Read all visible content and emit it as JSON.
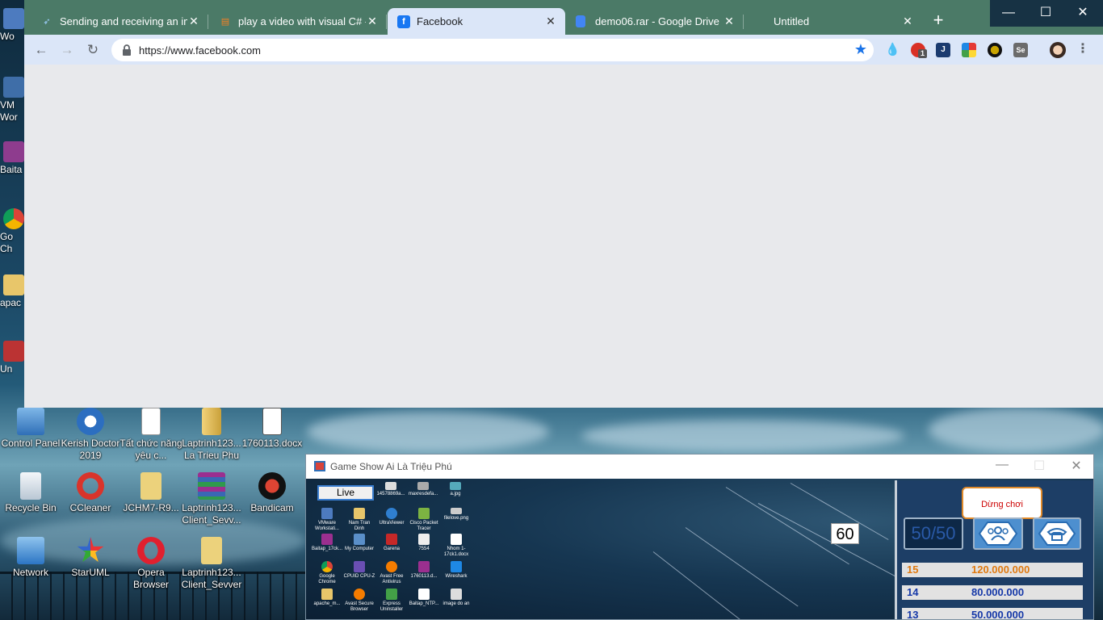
{
  "desktop": {
    "left_strip": [
      {
        "label": "Wo",
        "icon": "vmware-icon"
      },
      {
        "label": "VM\nWor",
        "icon": "vmware-icon"
      },
      {
        "label": "Baita",
        "icon": "winrar-icon"
      },
      {
        "label": "Go\nCh",
        "icon": "chrome-icon"
      },
      {
        "label": "apac",
        "icon": "folder-icon"
      },
      {
        "label": "Un",
        "icon": "uninstaller-icon"
      }
    ],
    "icons": [
      {
        "label": "Control Panel",
        "icon": "control-panel-icon"
      },
      {
        "label": "Kerish Doctor 2019",
        "icon": "kerish-doctor-icon"
      },
      {
        "label": "Tất chức năng yêu c...",
        "icon": "document-icon"
      },
      {
        "label": "Laptrinh123... La Trieu Phu",
        "icon": "winrar-archive-icon"
      },
      {
        "label": "1760113.docx",
        "icon": "docx-icon"
      },
      {
        "label": "Recycle Bin",
        "icon": "recycle-bin-icon"
      },
      {
        "label": "CCleaner",
        "icon": "ccleaner-icon"
      },
      {
        "label": "JCHM7-R9...",
        "icon": "folder-icon"
      },
      {
        "label": "Laptrinh123... Client_Sevv...",
        "icon": "winrar-archive-icon"
      },
      {
        "label": "Bandicam",
        "icon": "bandicam-icon"
      },
      {
        "label": "Network",
        "icon": "network-icon"
      },
      {
        "label": "StarUML",
        "icon": "staruml-icon"
      },
      {
        "label": "Opera Browser",
        "icon": "opera-icon"
      },
      {
        "label": "Laptrinh123... Client_Sevver",
        "icon": "folder-icon"
      }
    ]
  },
  "browser": {
    "tabs": [
      {
        "title": "Sending and receiving an ima",
        "favicon": "feather-icon",
        "active": false
      },
      {
        "title": "play a video with visual C# - S",
        "favicon": "stackoverflow-icon",
        "active": false
      },
      {
        "title": "Facebook",
        "favicon": "facebook-icon",
        "active": true
      },
      {
        "title": "demo06.rar - Google Drive",
        "favicon": "google-docs-icon",
        "active": false
      },
      {
        "title": "Untitled",
        "favicon": "",
        "active": false
      }
    ],
    "new_tab": "+",
    "url": "https://www.facebook.com",
    "window_controls": {
      "minimize": "—",
      "maximize": "☐",
      "close": "✕"
    },
    "extension_badge": "1",
    "extensions": [
      "raindrop-icon",
      "adblock-icon",
      "j-icon",
      "color-grid-icon",
      "dark-mode-icon",
      "selenium-icon",
      "profile-avatar-icon",
      "menu-dots-icon"
    ]
  },
  "game": {
    "title": "Game Show Ai Là Triệu Phú",
    "live_button": "Live",
    "timer": "60",
    "stop_button": "Dừng chơi",
    "lifelines": {
      "fifty": "50/50",
      "audience": "audience-icon",
      "phone": "phone-icon"
    },
    "prizes": [
      {
        "level": "15",
        "amount": "120.000.000",
        "color": "#e07a10"
      },
      {
        "level": "14",
        "amount": "80.000.000",
        "color": "#1538a8"
      },
      {
        "level": "13",
        "amount": "50.000.000",
        "color": "#1538a8"
      }
    ],
    "mini_desktop_icons": [
      [
        "",
        "14578869a...",
        "maxresdefa...",
        "a.jpg",
        ""
      ],
      [
        "VMware Workstati...",
        "Nam Tran Dinh",
        "UltraViewer",
        "Cisco Packet Tracer",
        "filelove.png"
      ],
      [
        "Baitap_17ck...",
        "My Computer",
        "Garena",
        "7554",
        "Nhom 1-17ck1.docx"
      ],
      [
        "Google Chrome",
        "CPUID CPU-Z",
        "Avast Free Antivirus",
        "1760113.d...",
        "Wireshark"
      ],
      [
        "apache_m...",
        "Avast Secure Browser",
        "Express Uninstaller",
        "Baitap_NTP...",
        "image do an"
      ]
    ]
  }
}
